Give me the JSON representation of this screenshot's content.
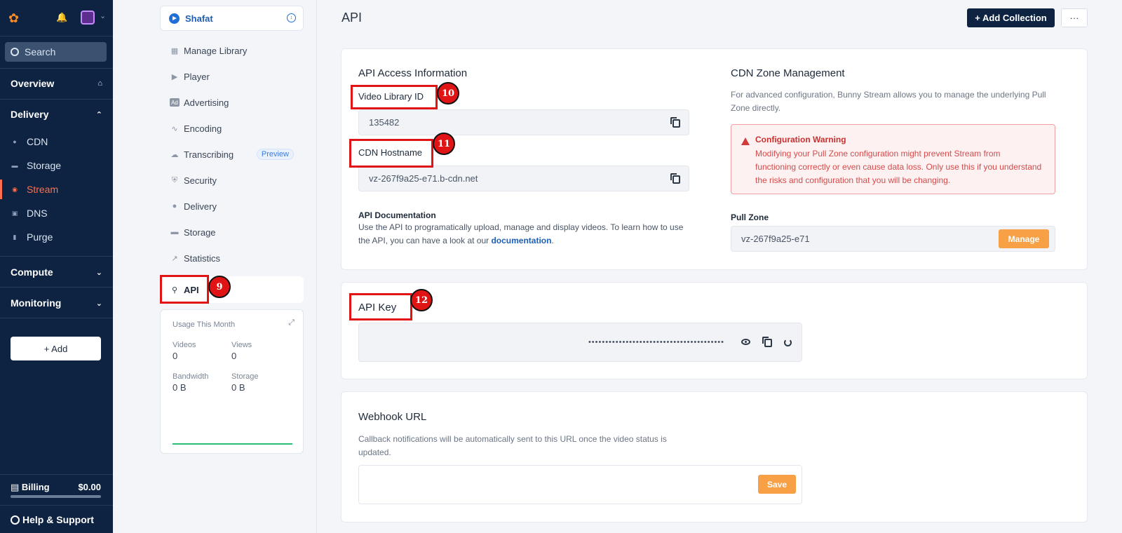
{
  "nav": {
    "search_placeholder": "Search",
    "overview": "Overview",
    "delivery": "Delivery",
    "items": [
      {
        "label": "CDN",
        "icon": "pin-icon"
      },
      {
        "label": "Storage",
        "icon": "storage-icon"
      },
      {
        "label": "Stream",
        "icon": "stream-icon"
      },
      {
        "label": "DNS",
        "icon": "dns-icon"
      },
      {
        "label": "Purge",
        "icon": "trash-icon"
      }
    ],
    "compute": "Compute",
    "monitoring": "Monitoring",
    "add": "+ Add",
    "billing_label": "Billing",
    "billing_value": "$0.00",
    "help": "Help & Support",
    "accent_color": "#ff6f4d"
  },
  "subnav": {
    "library_name": "Shafat",
    "items": [
      {
        "label": "Manage Library",
        "icon": "film-icon"
      },
      {
        "label": "Player",
        "icon": "play-icon"
      },
      {
        "label": "Advertising",
        "icon": "ad-icon"
      },
      {
        "label": "Encoding",
        "icon": "waveform-icon"
      },
      {
        "label": "Transcribing",
        "icon": "cloud-icon",
        "badge": "Preview"
      },
      {
        "label": "Security",
        "icon": "shield-icon"
      },
      {
        "label": "Delivery",
        "icon": "pin-icon"
      },
      {
        "label": "Storage",
        "icon": "storage-icon"
      },
      {
        "label": "Statistics",
        "icon": "chart-icon"
      },
      {
        "label": "API",
        "icon": "key-icon"
      }
    ],
    "usage": {
      "title": "Usage This Month",
      "videos_label": "Videos",
      "videos_value": "0",
      "views_label": "Views",
      "views_value": "0",
      "bandwidth_label": "Bandwidth",
      "bandwidth_value": "0 B",
      "storage_label": "Storage",
      "storage_value": "0 B"
    }
  },
  "main": {
    "title": "API",
    "add_collection": "+ Add Collection",
    "more": "···",
    "access": {
      "heading": "API Access Information",
      "library_id_label": "Video Library ID",
      "library_id_value": "135482",
      "hostname_label": "CDN Hostname",
      "hostname_value": "vz-267f9a25-e71.b-cdn.net",
      "doc_heading": "API Documentation",
      "doc_text": "Use the API to programatically upload, manage and display videos. To learn how to use the API, you can have a look at our ",
      "doc_link": "documentation",
      "doc_end": "."
    },
    "cdn": {
      "heading": "CDN Zone Management",
      "text": "For advanced configuration, Bunny Stream allows you to manage the underlying Pull Zone directly.",
      "warning_title": "Configuration Warning",
      "warning_text": "Modifying your Pull Zone configuration might prevent Stream from functioning correctly or even cause data loss. Only use this if you understand the risks and configuration that you will be changing.",
      "pull_zone_label": "Pull Zone",
      "pull_zone_value": "vz-267f9a25-e71",
      "manage": "Manage"
    },
    "api_key": {
      "heading": "API Key",
      "masked": "••••••••••••••••••••••••••••••••••••••••"
    },
    "webhook": {
      "heading": "Webhook URL",
      "text": "Callback notifications will be automatically sent to this URL once the video status is updated.",
      "input_value": "",
      "save": "Save"
    }
  },
  "annotations": [
    "9",
    "10",
    "11",
    "12"
  ]
}
